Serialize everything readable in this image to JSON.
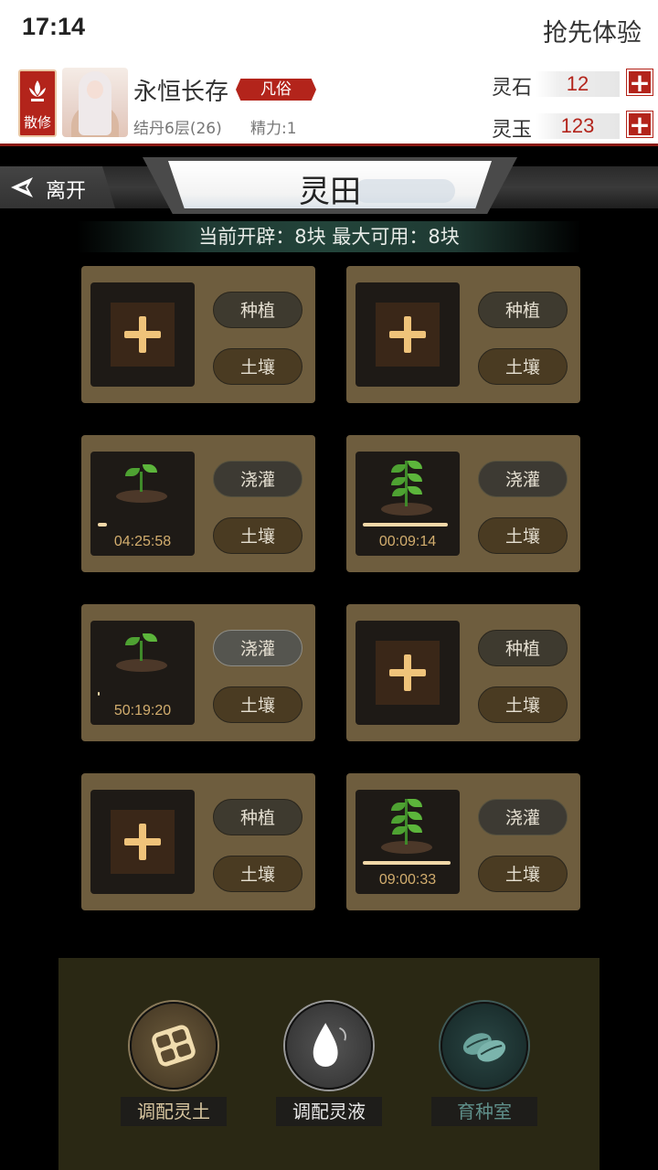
{
  "status": {
    "time": "17:14",
    "promo": "抢先体验"
  },
  "profile": {
    "sect_label": "散修",
    "name": "永恒长存",
    "rank": "凡俗",
    "level": "结丹6层(26)",
    "stamina": "精力:1"
  },
  "currencies": [
    {
      "name": "灵石",
      "value": "12"
    },
    {
      "name": "灵玉",
      "value": "123"
    }
  ],
  "titlebar": {
    "leave_label": "离开",
    "title": "灵田"
  },
  "plots_info": "当前开辟：8块 最大可用：8块",
  "plots": [
    {
      "state": "empty",
      "action": "种植",
      "soil": "土壤"
    },
    {
      "state": "empty",
      "action": "种植",
      "soil": "土壤"
    },
    {
      "state": "sprout",
      "action": "浇灌",
      "soil": "土壤",
      "timer": "04:25:58",
      "progress": 0.1
    },
    {
      "state": "grown",
      "action": "浇灌",
      "soil": "土壤",
      "timer": "00:09:14",
      "progress": 0.95
    },
    {
      "state": "sprout",
      "action": "浇灌",
      "soil": "土壤",
      "timer": "50:19:20",
      "progress": 0.01,
      "active": true
    },
    {
      "state": "empty",
      "action": "种植",
      "soil": "土壤"
    },
    {
      "state": "empty",
      "action": "种植",
      "soil": "土壤"
    },
    {
      "state": "grown",
      "action": "浇灌",
      "soil": "土壤",
      "timer": "09:00:33",
      "progress": 0.98
    }
  ],
  "tools": [
    {
      "label": "调配灵土",
      "icon": "soil-blend-icon",
      "color": "#6e5d3e",
      "text_color": "#d8c6a0"
    },
    {
      "label": "调配灵液",
      "icon": "water-drop-icon",
      "color": "#4a4a4a",
      "text_color": "#e8e8e8"
    },
    {
      "label": "育种室",
      "icon": "seed-icon",
      "color": "#243a38",
      "text_color": "#5f8f8a"
    }
  ],
  "colors": {
    "accent_red": "#b3241b",
    "card": "#6e5d3e",
    "gold": "#efc37a"
  }
}
